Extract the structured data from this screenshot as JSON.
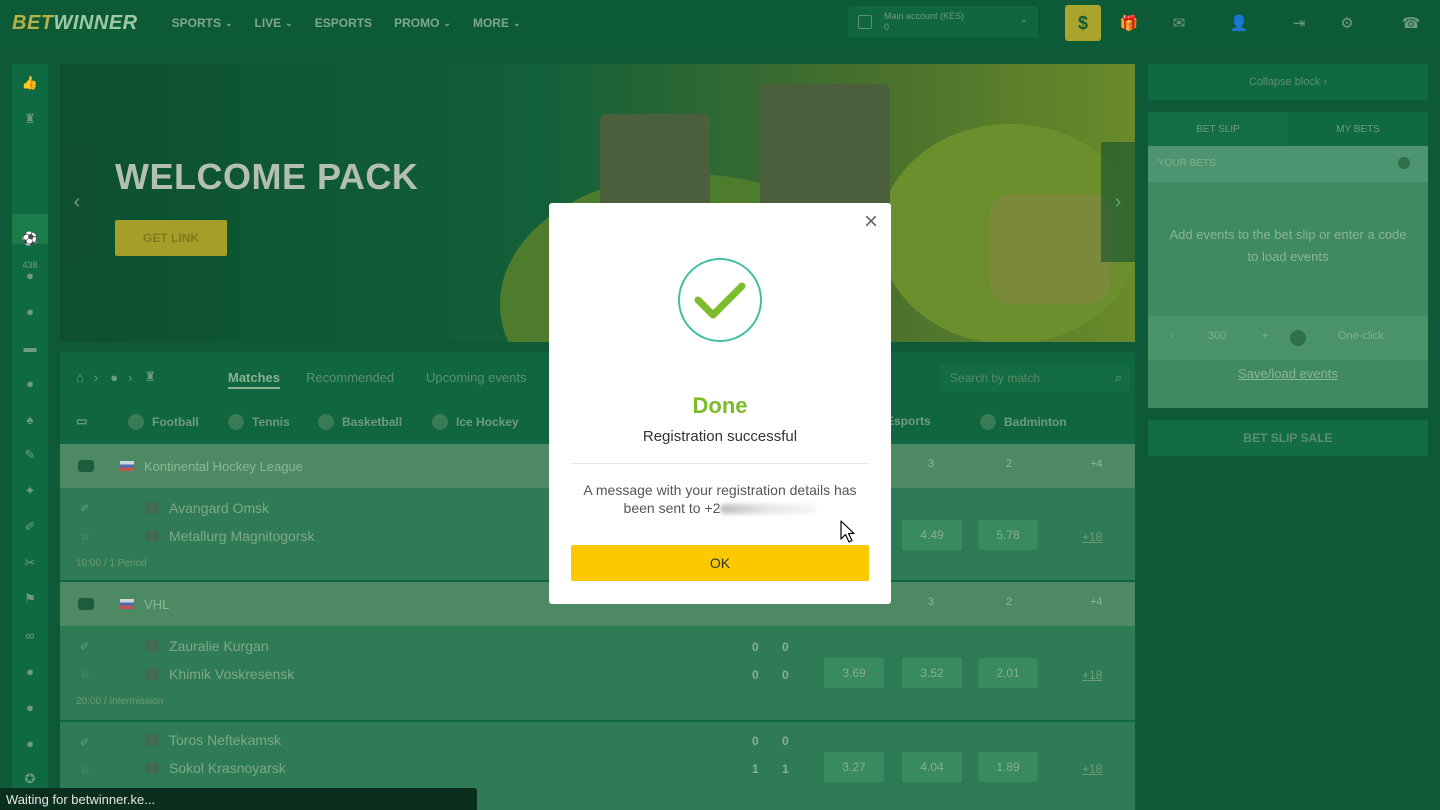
{
  "header": {
    "logo_bet": "BET",
    "logo_winner": "WINNER",
    "nav": [
      {
        "label": "SPORTS"
      },
      {
        "label": "LIVE"
      },
      {
        "label": "ESPORTS"
      },
      {
        "label": "PROMO"
      },
      {
        "label": "MORE"
      }
    ],
    "account_label": "Main account (KES)",
    "account_balance": "0",
    "deposit_symbol": "$"
  },
  "sidebar_left": {
    "live_count": "438"
  },
  "banner": {
    "title": "WELCOME PACK",
    "button": "GET LINK"
  },
  "main": {
    "tabs": [
      "Matches",
      "Recommended",
      "Upcoming events"
    ],
    "search_placeholder": "Search by match",
    "sports": [
      "Football",
      "Tennis",
      "Basketball",
      "Ice Hockey",
      "Esports",
      "Badminton"
    ],
    "leagues": [
      {
        "name": "Kontinental Hockey League",
        "cols": [
          "3",
          "2",
          "+4"
        ],
        "matches": [
          {
            "team1": "Avangard Omsk",
            "team2": "Metallurg Magnitogorsk",
            "meta": "19:00 / 1 Period",
            "odds": [
              "4.49",
              "5.78"
            ],
            "more": "+18"
          }
        ]
      },
      {
        "name": "VHL",
        "cols": [
          "3",
          "2",
          "+4"
        ],
        "matches": [
          {
            "team1": "Zauralie Kurgan",
            "team2": "Khimik Voskresensk",
            "meta": "20:00 / Intermission",
            "score1": [
              "0",
              "0"
            ],
            "score2": [
              "0",
              "0"
            ],
            "odds": [
              "3.69",
              "3.52",
              "2.01"
            ],
            "more": "+18"
          },
          {
            "team1": "Toros Neftekamsk",
            "team2": "Sokol Krasnoyarsk",
            "score1": [
              "0",
              "0"
            ],
            "score2": [
              "1",
              "1"
            ],
            "odds": [
              "3.27",
              "4.04",
              "1.89"
            ],
            "more": "+18"
          }
        ]
      }
    ]
  },
  "betslip": {
    "collapse": "Collapse block",
    "tabs": [
      "BET SLIP",
      "MY BETS"
    ],
    "your_bets": "YOUR BETS",
    "empty_msg": "Add events to the bet slip or enter a code to load events",
    "stake": "300",
    "one_click": "One-click",
    "save_load": "Save/load events",
    "sale": "BET SLIP SALE"
  },
  "modal": {
    "title": "Done",
    "subtitle": "Registration successful",
    "message": "A message with your registration details has been sent to",
    "phone_prefix": "+2",
    "ok": "OK",
    "accent": "#7cbb2a",
    "button_color": "#fcc900"
  },
  "statusbar": {
    "text": "Waiting for betwinner.ke..."
  }
}
